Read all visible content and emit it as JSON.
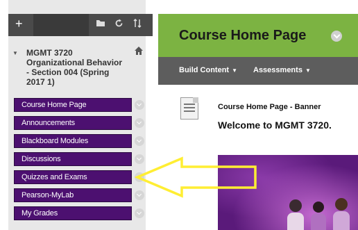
{
  "sidebar": {
    "toolbar": {
      "add_icon": "plus-icon",
      "icons": [
        "folder-icon",
        "refresh-icon",
        "sort-icon"
      ]
    },
    "course": {
      "title": "MGMT 3720 Organizational Behavior - Section 004 (Spring 2017 1)",
      "title_lines": [
        "MGMT 3720",
        "Organizational Behavior",
        "- Section 004 (Spring",
        "2017 1)"
      ]
    },
    "menu_items": [
      {
        "label": "Course Home Page"
      },
      {
        "label": "Announcements"
      },
      {
        "label": "Blackboard Modules"
      },
      {
        "label": "Discussions"
      },
      {
        "label": "Quizzes and Exams"
      },
      {
        "label": "Pearson-MyLab"
      },
      {
        "label": "My Grades"
      }
    ]
  },
  "main": {
    "page_title": "Course Home Page",
    "actions": [
      {
        "label": "Build Content"
      },
      {
        "label": "Assessments"
      }
    ],
    "item_title": "Course Home Page - Banner",
    "welcome_text": "Welcome to MGMT 3720."
  },
  "annotation": {
    "arrow_color": "#ffee33",
    "points_to": "Quizzes and Exams"
  },
  "colors": {
    "menu_purple": "#4c1070",
    "header_green": "#7cb342",
    "action_bar": "#5d5d5d"
  }
}
